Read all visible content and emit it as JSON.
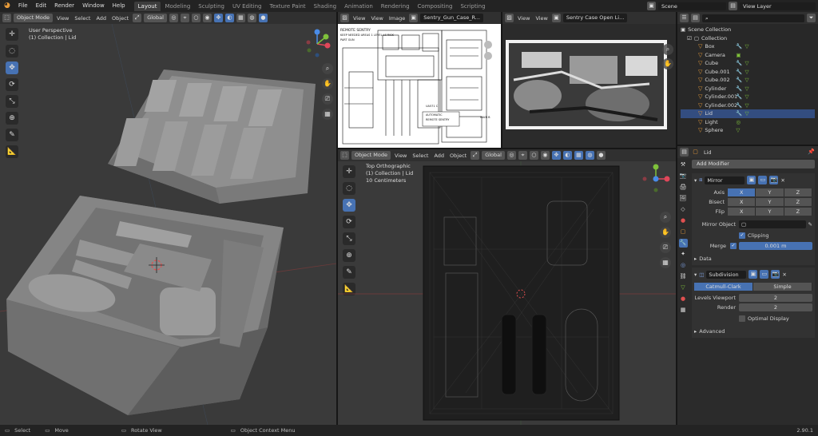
{
  "menu": [
    "File",
    "Edit",
    "Render",
    "Window",
    "Help"
  ],
  "workspaces": [
    {
      "label": "Layout",
      "active": true
    },
    {
      "label": "Modeling"
    },
    {
      "label": "Sculpting"
    },
    {
      "label": "UV Editing"
    },
    {
      "label": "Texture Paint"
    },
    {
      "label": "Shading"
    },
    {
      "label": "Animation"
    },
    {
      "label": "Rendering"
    },
    {
      "label": "Compositing"
    },
    {
      "label": "Scripting"
    }
  ],
  "scene": {
    "name": "Scene",
    "view_layer": "View Layer"
  },
  "left_viewport": {
    "mode": "Object Mode",
    "menus": [
      "View",
      "Select",
      "Add",
      "Object"
    ],
    "orientation": "Global",
    "overlay_line1": "User Perspective",
    "overlay_line2": "(1) Collection | Lid"
  },
  "image_editor_1": {
    "menus": [
      "View",
      "View",
      "Image"
    ],
    "image_name": "Sentry_Gun_Case_R..."
  },
  "image_editor_2": {
    "menus": [
      "View",
      "View"
    ],
    "image_name": "Sentry Case Open Li..."
  },
  "blueprint_text": {
    "t1": "REMOTE SENTRY",
    "t2": "KEEP NEEDED AREAS 1 LEVEL LS RISK",
    "t3": "PART GUN",
    "t4": "UA571 C",
    "t5": "AUTOMATIC",
    "t6": "REMOTE SENTRY",
    "t7": "MAIN B"
  },
  "right_viewport": {
    "mode": "Object Mode",
    "menus": [
      "View",
      "Select",
      "Add",
      "Object"
    ],
    "orientation": "Global",
    "overlay_line1": "Top Orthographic",
    "overlay_line2": "(1) Collection | Lid",
    "overlay_line3": "10 Centimeters"
  },
  "outliner": {
    "search_placeholder": "",
    "items": [
      {
        "label": "Scene Collection",
        "level": 0
      },
      {
        "label": "Collection",
        "level": 1
      },
      {
        "label": "Box",
        "level": 2
      },
      {
        "label": "Camera",
        "level": 2
      },
      {
        "label": "Cube",
        "level": 2
      },
      {
        "label": "Cube.001",
        "level": 2
      },
      {
        "label": "Cube.002",
        "level": 2
      },
      {
        "label": "Cylinder",
        "level": 2
      },
      {
        "label": "Cylinder.001",
        "level": 2
      },
      {
        "label": "Cylinder.002",
        "level": 2
      },
      {
        "label": "Lid",
        "level": 2,
        "selected": true
      },
      {
        "label": "Light",
        "level": 2
      },
      {
        "label": "Sphere",
        "level": 2
      }
    ]
  },
  "properties": {
    "object_name": "Lid",
    "add_modifier": "Add Modifier",
    "mirror": {
      "name": "Mirror",
      "axis_label": "Axis",
      "bisect_label": "Bisect",
      "flip_label": "Flip",
      "axes": [
        "X",
        "Y",
        "Z"
      ],
      "mirror_object_label": "Mirror Object",
      "clipping_label": "Clipping",
      "merge_label": "Merge",
      "merge_value": "0.001 m",
      "data_label": "Data"
    },
    "subdivision": {
      "name": "Subdivision",
      "method_a": "Catmull-Clark",
      "method_b": "Simple",
      "levels_viewport_label": "Levels Viewport",
      "levels_viewport_value": "2",
      "render_label": "Render",
      "render_value": "2",
      "optimal_label": "Optimal Display",
      "advanced_label": "Advanced"
    }
  },
  "status": {
    "select": "Select",
    "move": "Move",
    "rotate": "Rotate View",
    "context": "Object Context Menu",
    "version": "2.90.1"
  },
  "colors": {
    "accent": "#4772b3",
    "mesh": "#8b8b8b",
    "orange": "#e59a3a"
  }
}
